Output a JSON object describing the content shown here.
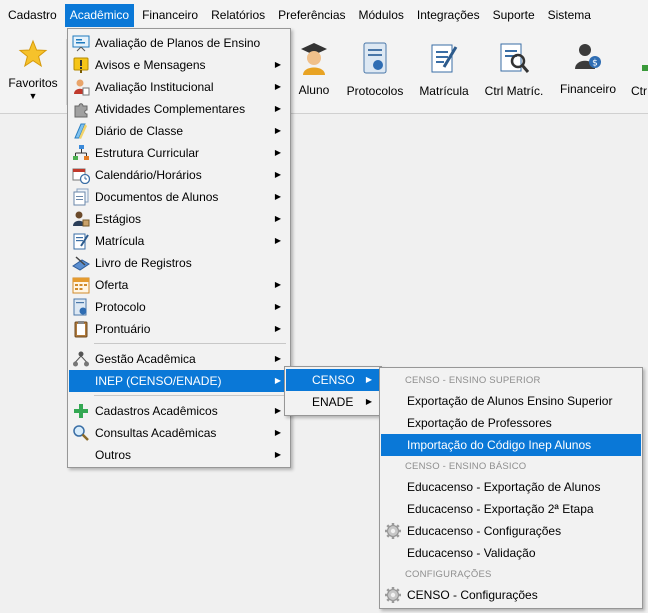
{
  "menubar": {
    "items": [
      "Cadastro",
      "Acadêmico",
      "Financeiro",
      "Relatórios",
      "Preferências",
      "Módulos",
      "Integrações",
      "Suporte",
      "Sistema"
    ],
    "active_index": 1
  },
  "toolbar": {
    "favoritos": "Favoritos",
    "aluno": "Aluno",
    "protocolos": "Protocolos",
    "matricula": "Matrícula",
    "ctrl_matric": "Ctrl Matríc.",
    "financeiro": "Financeiro",
    "ctrl_cut": "Ctr"
  },
  "academico_menu": {
    "items": [
      {
        "label": "Avaliação de Planos de Ensino",
        "icon": "presentation-board-icon",
        "submenu": false
      },
      {
        "label": "Avisos e Mensagens",
        "icon": "exclamation-sign-icon",
        "submenu": true
      },
      {
        "label": "Avaliação Institucional",
        "icon": "person-evaluation-icon",
        "submenu": true
      },
      {
        "label": "Atividades Complementares",
        "icon": "puzzle-icon",
        "submenu": true
      },
      {
        "label": "Diário de Classe",
        "icon": "diary-icon",
        "submenu": true
      },
      {
        "label": "Estrutura Curricular",
        "icon": "hierarchy-icon",
        "submenu": true
      },
      {
        "label": "Calendário/Horários",
        "icon": "calendar-clock-icon",
        "submenu": true
      },
      {
        "label": "Documentos de Alunos",
        "icon": "documents-icon",
        "submenu": true
      },
      {
        "label": "Estágios",
        "icon": "internship-icon",
        "submenu": true
      },
      {
        "label": "Matrícula",
        "icon": "form-pen-icon",
        "submenu": true
      },
      {
        "label": "Livro de Registros",
        "icon": "book-pen-icon",
        "submenu": false
      },
      {
        "label": "Oferta",
        "icon": "calendar-grid-icon",
        "submenu": true
      },
      {
        "label": "Protocolo",
        "icon": "protocol-icon",
        "submenu": true
      },
      {
        "label": "Prontuário",
        "icon": "clipboard-icon",
        "submenu": true
      },
      {
        "label": "Gestão Acadêmica",
        "icon": "org-chart-icon",
        "submenu": true
      },
      {
        "label": "INEP (CENSO/ENADE)",
        "icon": "",
        "submenu": true
      },
      {
        "label": "Cadastros Acadêmicos",
        "icon": "plus-icon",
        "submenu": true
      },
      {
        "label": "Consultas Acadêmicas",
        "icon": "magnifier-icon",
        "submenu": true
      },
      {
        "label": "Outros",
        "icon": "",
        "submenu": true
      }
    ]
  },
  "inep_menu": {
    "items": [
      {
        "label": "CENSO",
        "submenu": true
      },
      {
        "label": "ENADE",
        "submenu": true
      }
    ]
  },
  "censo_menu": {
    "header_superior": "CENSO - ENSINO SUPERIOR",
    "header_basico": "CENSO - ENSINO BÁSICO",
    "header_config": "CONFIGURAÇÕES",
    "items": [
      "Exportação de Alunos Ensino Superior",
      "Exportação de Professores",
      "Importação do Código Inep Alunos",
      "Educacenso - Exportação de Alunos",
      "Educacenso - Exportação 2ª Etapa",
      "Educacenso - Configurações",
      "Educacenso - Validação",
      "CENSO - Configurações"
    ]
  },
  "colors": {
    "highlight": "#0a78d7",
    "menu_bg": "#f2f2f2"
  }
}
